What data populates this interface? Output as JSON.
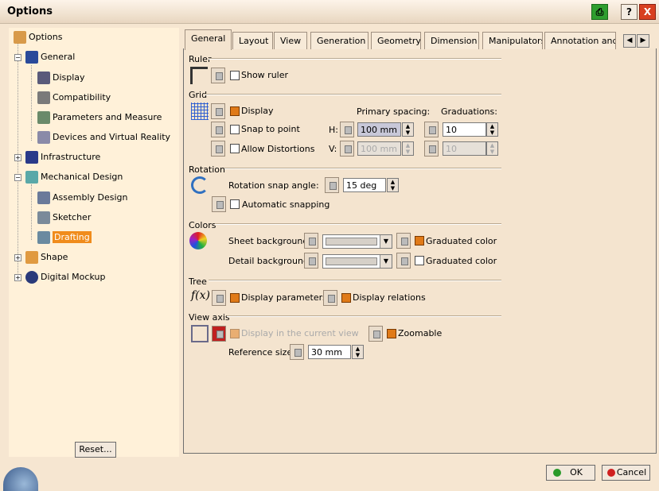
{
  "window": {
    "title": "Options"
  },
  "tree": {
    "root": "Options",
    "items": [
      "General",
      "Display",
      "Compatibility",
      "Parameters and Measure",
      "Devices and Virtual Reality",
      "Infrastructure",
      "Mechanical Design",
      "Assembly Design",
      "Sketcher",
      "Drafting",
      "Shape",
      "Digital Mockup"
    ],
    "selected": "Drafting"
  },
  "tabs": [
    "General",
    "Layout",
    "View",
    "Generation",
    "Geometry",
    "Dimension",
    "Manipulators",
    "Annotation and D"
  ],
  "active_tab": "General",
  "ruler": {
    "title": "Ruler",
    "show_ruler": "Show ruler"
  },
  "grid": {
    "title": "Grid",
    "display": "Display",
    "snap": "Snap to point",
    "allow": "Allow Distortions",
    "primary_spacing": "Primary spacing:",
    "graduations": "Graduations:",
    "h": "H:",
    "v": "V:",
    "h_spacing": "100 mm",
    "v_spacing": "100 mm",
    "h_grad": "10",
    "v_grad": "10"
  },
  "rotation": {
    "title": "Rotation",
    "snap_angle_label": "Rotation snap angle:",
    "snap_angle": "15 deg",
    "auto": "Automatic snapping"
  },
  "colors": {
    "title": "Colors",
    "sheet_bg": "Sheet background:",
    "detail_bg": "Detail background:",
    "graduated": "Graduated color"
  },
  "tree_sec": {
    "title": "Tree",
    "disp_params": "Display parameters",
    "disp_rel": "Display relations"
  },
  "view_axis": {
    "title": "View axis",
    "display_current": "Display in the current view",
    "zoomable": "Zoomable",
    "ref_size_label": "Reference size:",
    "ref_size": "30 mm"
  },
  "buttons": {
    "reset": "Reset...",
    "ok": "OK",
    "cancel": "Cancel"
  },
  "icons": {
    "tray": "printer-icon",
    "help": "?",
    "close": "X"
  }
}
